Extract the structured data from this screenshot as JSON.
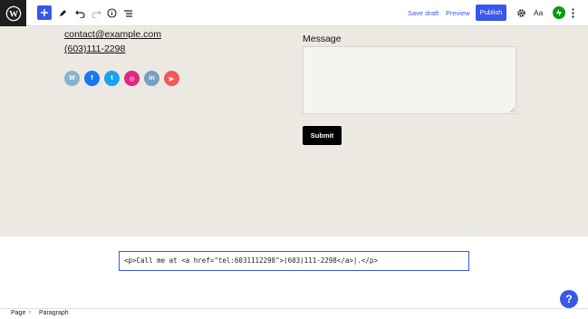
{
  "toolbar": {
    "save_draft": "Save draft",
    "preview": "Preview",
    "publish": "Publish",
    "typography": "Aa",
    "icons": [
      "wordpress-logo-icon",
      "plus-icon",
      "pencil-icon",
      "undo-icon",
      "redo-icon",
      "info-icon",
      "list-view-icon",
      "gear-icon",
      "jetpack-icon",
      "more-vertical-icon"
    ]
  },
  "contact": {
    "email": "contact@example.com",
    "phone": "(603)111-2298"
  },
  "social_icons": [
    {
      "name": "wordpress-icon",
      "color": "#8ab2cc"
    },
    {
      "name": "facebook-icon",
      "color": "#1877f2"
    },
    {
      "name": "twitter-icon",
      "color": "#1da1f2"
    },
    {
      "name": "instagram-icon",
      "color": "#e4267f"
    },
    {
      "name": "linkedin-icon",
      "color": "#7a9ec2"
    },
    {
      "name": "youtube-icon",
      "color": "#f5575d"
    }
  ],
  "form": {
    "message_label": "Message",
    "message_value": "",
    "submit_label": "Submit"
  },
  "html_editor": {
    "content": "<p>Call me at <a href=\"tel:6031112298\">(603)111-2298</a>|.</p>"
  },
  "help_label": "?",
  "breadcrumb": {
    "page": "Page",
    "separator": "›",
    "paragraph": "Paragraph"
  },
  "colors": {
    "accent": "#3858e9",
    "canvas_bg": "#ece9e2",
    "jetpack": "#069e08"
  }
}
